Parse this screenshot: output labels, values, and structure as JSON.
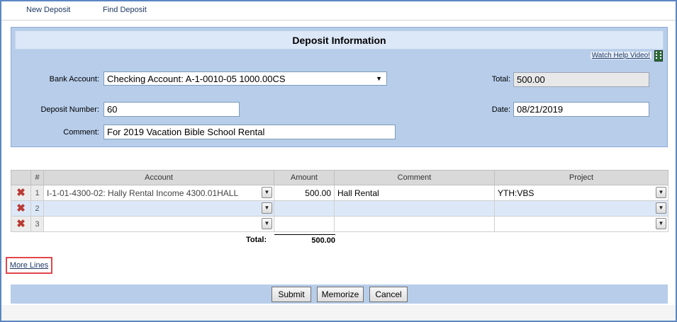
{
  "nav": {
    "new_deposit": "New Deposit",
    "find_deposit": "Find Deposit"
  },
  "panel": {
    "title": "Deposit Information",
    "help_link": "Watch Help Video!",
    "bank_account_label": "Bank Account:",
    "bank_account_value": "Checking Account: A-1-0010-05 1000.00CS",
    "total_label": "Total:",
    "total_value": "500.00",
    "deposit_number_label": "Deposit Number:",
    "deposit_number_value": "60",
    "date_label": "Date:",
    "date_value": "08/21/2019",
    "comment_label": "Comment:",
    "comment_value": "For 2019 Vacation Bible School Rental"
  },
  "grid": {
    "columns": {
      "num": "#",
      "account": "Account",
      "amount": "Amount",
      "comment": "Comment",
      "project": "Project"
    },
    "rows": [
      {
        "num": "1",
        "account": "I-1-01-4300-02: Hally Rental Income 4300.01HALL",
        "amount": "500.00",
        "comment": "Hall Rental",
        "project": "YTH:VBS"
      },
      {
        "num": "2",
        "account": "",
        "amount": "",
        "comment": "",
        "project": ""
      },
      {
        "num": "3",
        "account": "",
        "amount": "",
        "comment": "",
        "project": ""
      }
    ],
    "total_label": "Total:",
    "total_value": "500.00"
  },
  "more_lines": "More Lines",
  "buttons": {
    "submit": "Submit",
    "memorize": "Memorize",
    "cancel": "Cancel"
  },
  "colors": {
    "panel_bg": "#b7cdea",
    "title_bg": "#dce8f7",
    "delete_icon": "#b93a32",
    "highlight_box": "#e0474c"
  }
}
